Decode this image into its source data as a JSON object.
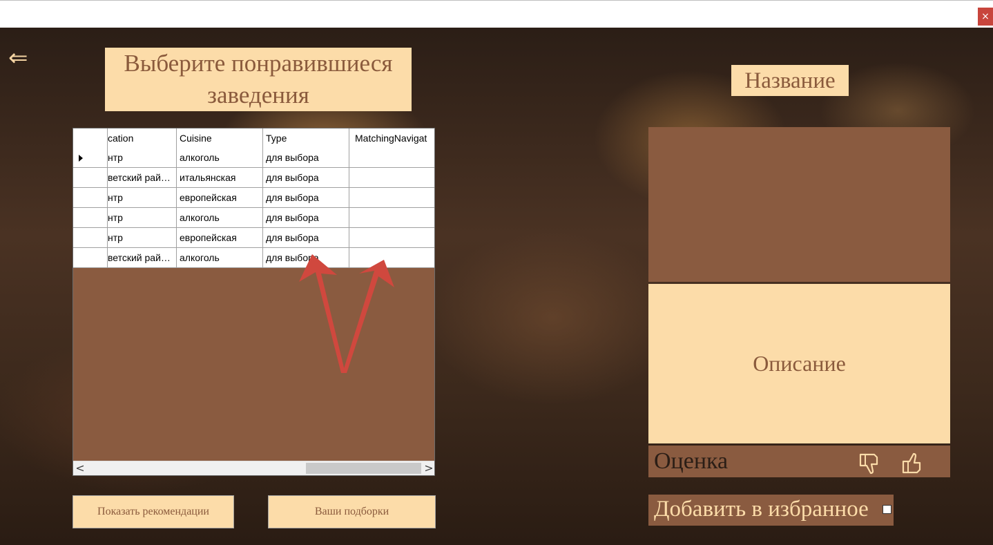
{
  "window": {
    "close_glyph": "×"
  },
  "back_glyph": "⇐",
  "header": {
    "line1": "Выберите понравившиеся",
    "line2": "заведения"
  },
  "grid": {
    "columns": [
      "cation",
      "Cuisine",
      "Type",
      "MatchingNavigat"
    ],
    "rows": [
      {
        "location": "нтр",
        "cuisine": "алкоголь",
        "type": "для выбора",
        "matching": "",
        "current": true
      },
      {
        "location": "ветский рай…",
        "cuisine": "итальянская",
        "type": "для выбора",
        "matching": "",
        "current": false
      },
      {
        "location": "нтр",
        "cuisine": "европейская",
        "type": "для выбора",
        "matching": "",
        "current": false
      },
      {
        "location": "нтр",
        "cuisine": "алкоголь",
        "type": "для выбора",
        "matching": "",
        "current": false
      },
      {
        "location": "нтр",
        "cuisine": "европейская",
        "type": "для выбора",
        "matching": "",
        "current": false
      },
      {
        "location": "ветский рай…",
        "cuisine": "алкоголь",
        "type": "для выбора",
        "matching": "",
        "current": false
      }
    ],
    "scroll_left": "<",
    "scroll_right": ">"
  },
  "buttons": {
    "recommendations": "Показать рекомендации",
    "collections": "Ваши подборки"
  },
  "details": {
    "name": "Название",
    "description": "Описание",
    "rating_label": "Оценка",
    "favorite_label": "Добавить в избранное",
    "favorite_checked": false
  },
  "colors": {
    "cream": "#fcdca9",
    "brown": "#8a5b40",
    "text_brown": "#8a5a3c",
    "annotation_red": "#d0483e"
  },
  "icons": [
    "back-arrow-icon",
    "close-icon",
    "thumbs-down-icon",
    "thumbs-up-icon"
  ]
}
